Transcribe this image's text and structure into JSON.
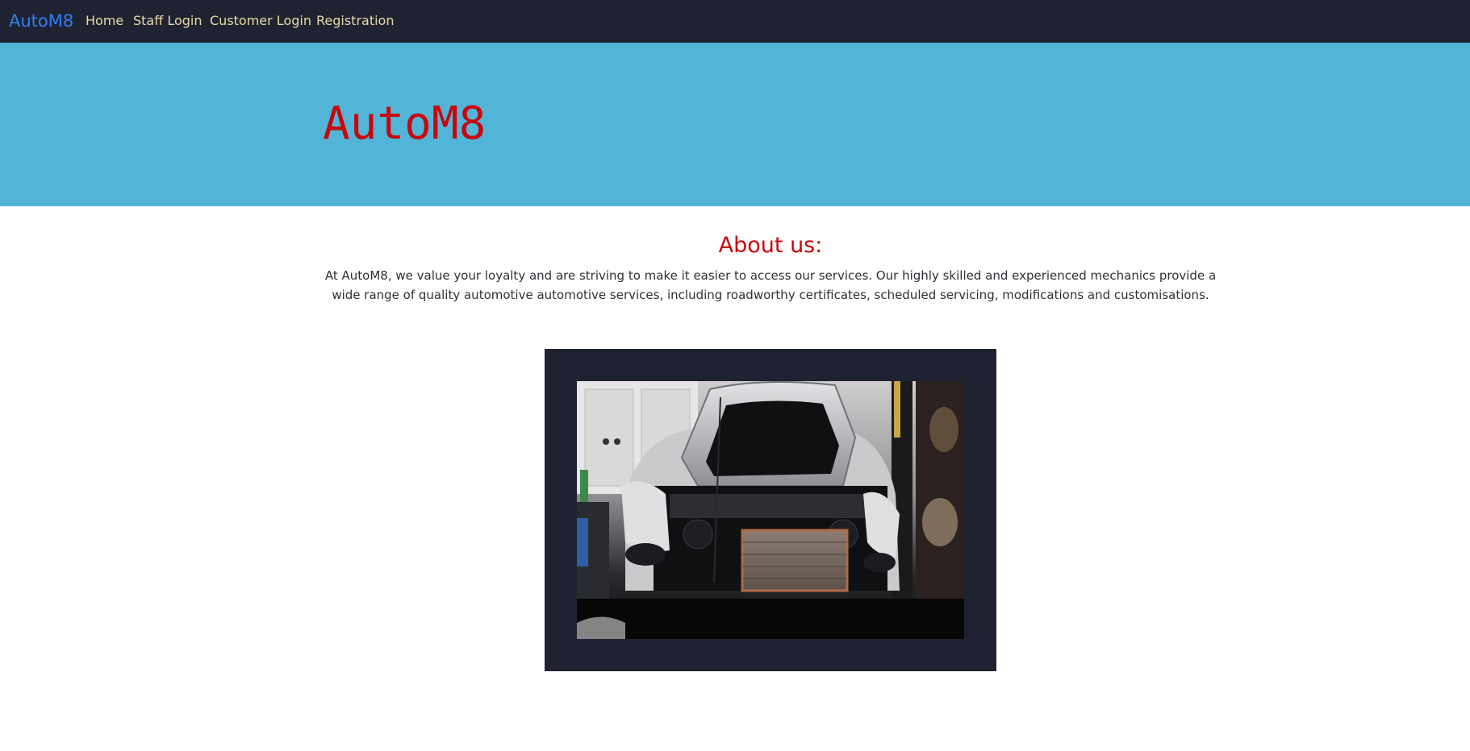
{
  "navbar": {
    "brand": "AutoM8",
    "links": [
      "Home",
      "Staff Login",
      "Customer Login",
      "Registration"
    ]
  },
  "hero": {
    "title": "AutoM8"
  },
  "about": {
    "heading": "About us:",
    "text": "At AutoM8, we value your loyalty and are striving to make it easier to access our services. Our highly skilled and experienced mechanics provide a wide range of quality automotive automotive services, including roadworthy certificates, scheduled servicing, modifications and customisations."
  },
  "colors": {
    "navbar_bg": "#1f2331",
    "brand": "#2f7ff2",
    "nav_link": "#e9d9a5",
    "hero_bg": "#52b5d8",
    "accent_red": "#c8060b",
    "frame_bg": "#1f2331"
  }
}
